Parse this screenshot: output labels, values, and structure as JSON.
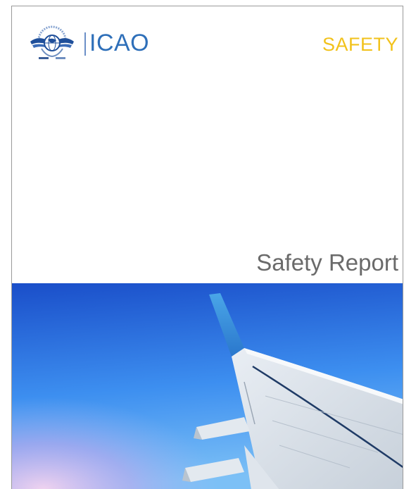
{
  "header": {
    "organization": "ICAO",
    "category": "SAFETY"
  },
  "document": {
    "title": "Safety Report"
  },
  "graphics": {
    "emblem": "icao-emblem-icon",
    "cover_photo": "airplane-wing-sky-photo"
  },
  "colors": {
    "brand_blue": "#2e6fb9",
    "safety_yellow": "#f2c21b",
    "title_gray": "#6a6a6a",
    "sky_top": "#1a4ec9",
    "sky_mid": "#3d8ff0",
    "wing_tip": "#2f8ad8"
  }
}
